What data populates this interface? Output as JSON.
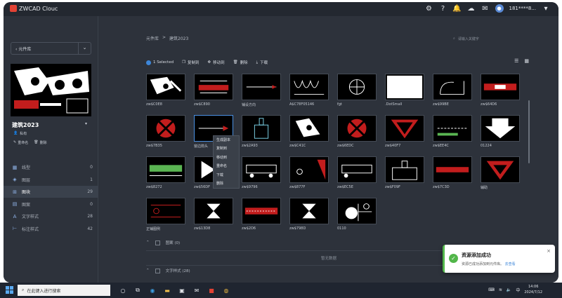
{
  "app": {
    "name": "ZWCAD Clouc",
    "user": "181****8..."
  },
  "sidebar": {
    "library_select": "元件库",
    "library_name": "建筑2023",
    "owner_label": "私有",
    "rename_label": "重命名",
    "delete_label": "删除",
    "items": [
      {
        "label": "线型",
        "count": "0"
      },
      {
        "label": "图层",
        "count": "1"
      },
      {
        "label": "图块",
        "count": "29"
      },
      {
        "label": "图案",
        "count": "0"
      },
      {
        "label": "文字样式",
        "count": "28"
      },
      {
        "label": "标注样式",
        "count": "42"
      }
    ]
  },
  "main": {
    "breadcrumb": [
      "元件库",
      "建筑2023"
    ],
    "search_placeholder": "请输入关键字",
    "toolbar": {
      "selected": "1 Selected",
      "copy": "复制到",
      "move": "移动到",
      "delete": "删除",
      "download": "下载"
    },
    "blocks": [
      "zw$C0E8",
      "zw$C890",
      "铺设方向",
      "A$C78F05146",
      "fgt",
      ".DotSmall",
      "zw$99BE",
      "zw$64D6",
      "zw$7B35",
      "窗边箭头",
      "zw$2A93",
      "zw$C41C",
      "zw$6EDC",
      "zw$40F7",
      "zw$EE4C",
      "01224",
      "zw$8272",
      "zw$56DF",
      "zw$9796",
      "zw$877F",
      "zw$EC5E",
      "zw$F09F",
      "zw$7C3D",
      "辅助",
      "正铺图例",
      "zw$13D8",
      "zw$2D6",
      "zw$798D",
      "0110"
    ],
    "context_menu": [
      "生成副本",
      "复制到",
      "移动到",
      "重命名",
      "下载",
      "删除"
    ],
    "section_pattern": "图案 (0)",
    "section_pattern_nodata": "暂无数据",
    "section_text": "文字样式 (28)"
  },
  "toast": {
    "title": "资源添加成功",
    "message": "资源已成功添加到元件库。",
    "link": "去查看"
  },
  "taskbar": {
    "search_placeholder": "在此键入进行搜索",
    "time": "14:06",
    "date": "2024/7/12"
  }
}
